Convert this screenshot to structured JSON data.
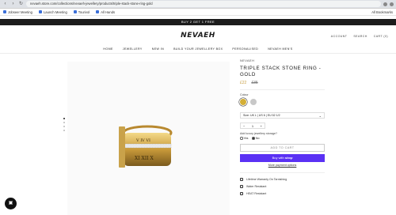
{
  "browser": {
    "url": "nevaeh.store.com/collections/nevaeh-jewellery/products/triple-stack-stone-ring-gold",
    "bookmarks": [
      "Jobseer Meeting",
      "Launch Meeting",
      "Tourivol",
      "All Hands"
    ],
    "all_bookmarks": "All Bookmarks"
  },
  "promo": "BUY 2 GET 1 FREE",
  "header": {
    "logo": "NEVAEH",
    "account": "ACCOUNT",
    "search": "SEARCH",
    "cart": "CART (0)"
  },
  "menu": [
    "HOME",
    "JEWELLERY",
    "NEW IN",
    "BUILD YOUR JEWELLERY BOX",
    "PERSONALISED",
    "NEVAEH MEN'S"
  ],
  "product": {
    "brand": "NEVAEH",
    "title": "TRIPLE STACK STONE RING - GOLD",
    "price": "£22",
    "compare_price": "£35",
    "colour_label": "Colour",
    "size_value": "Size: UK L | US 6 | EU 52 1/2",
    "quantity": "1",
    "minus": "−",
    "plus": "+",
    "storage_label": "Add luxury jewellery storage?",
    "yes": "Yes",
    "no": "No",
    "add_to_cart": "ADD TO CART",
    "buy_with": "Buy with",
    "shop_pay": "shop",
    "more_options": "More payment options",
    "features": [
      "Lifetime Warranty On Tarnishing",
      "Water Resistant",
      "HEAT Resistant"
    ]
  },
  "colors": {
    "accent_gold": "#d4af37",
    "shop_pay": "#5a31f4",
    "price": "#c9a24a"
  }
}
